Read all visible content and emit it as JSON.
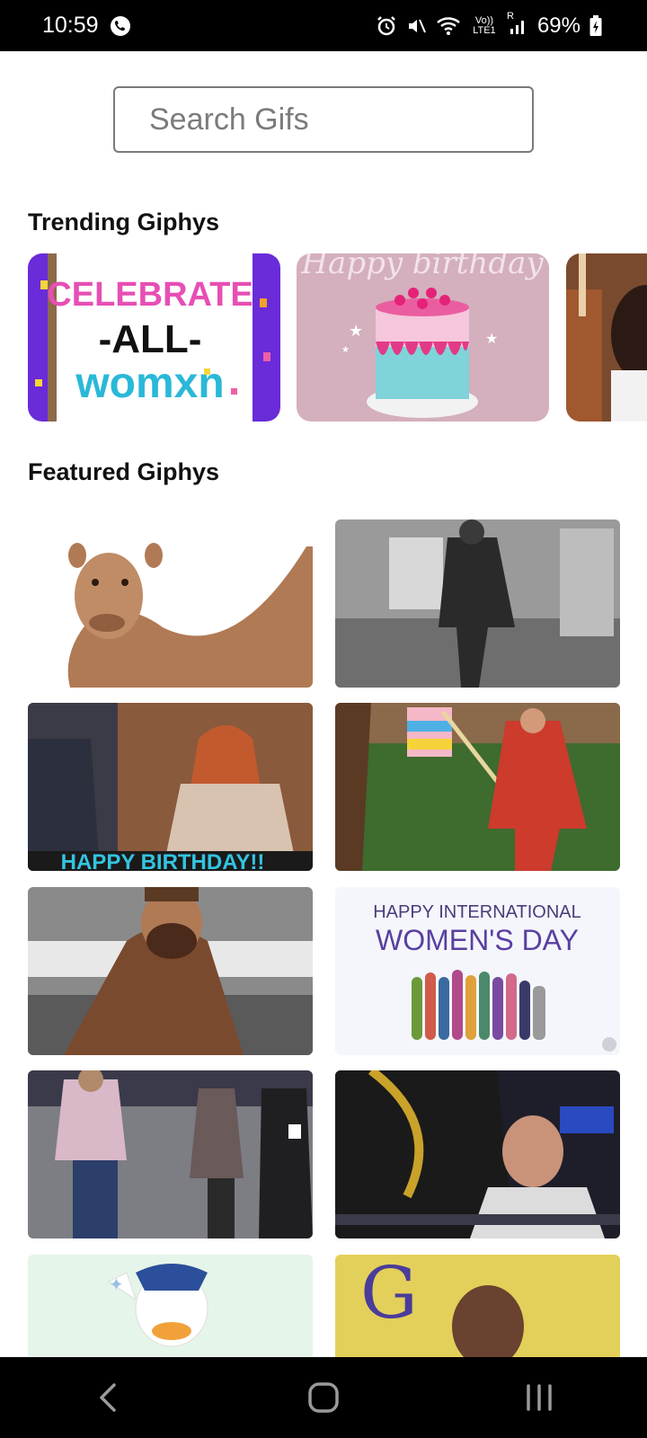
{
  "status_bar": {
    "time": "10:59",
    "battery": "69%",
    "icons": [
      "phone-call-icon",
      "alarm-icon",
      "mute-icon",
      "wifi-icon",
      "volte-icon",
      "signal-icon",
      "battery-icon"
    ],
    "volte_label": "Vo)) LTE1",
    "roaming_label": "R"
  },
  "search": {
    "placeholder": "Search Gifs",
    "value": ""
  },
  "trending": {
    "title": "Trending Giphys",
    "cards": [
      {
        "text_lines": [
          "CELEBRATE",
          "-ALL-",
          "womxn"
        ]
      },
      {
        "text_lines": [
          "Happy birthday"
        ]
      },
      {
        "text_lines": []
      }
    ]
  },
  "featured": {
    "title": "Featured Giphys",
    "items": [
      {
        "text_lines": []
      },
      {
        "text_lines": []
      },
      {
        "text_lines": [
          "HAPPY BIRTHDAY!!"
        ]
      },
      {
        "text_lines": []
      },
      {
        "text_lines": []
      },
      {
        "text_lines": [
          "HAPPY INTERNATIONAL",
          "WOMEN'S DAY"
        ]
      },
      {
        "text_lines": []
      },
      {
        "text_lines": []
      },
      {
        "text_lines": []
      },
      {
        "text_lines": [
          "G"
        ]
      }
    ]
  },
  "nav": {
    "icons": [
      "back-icon",
      "home-icon",
      "recents-icon"
    ]
  },
  "colors": {
    "status_bar_bg": "#000000",
    "page_bg": "#ffffff",
    "nav_bar_bg": "#000000"
  }
}
